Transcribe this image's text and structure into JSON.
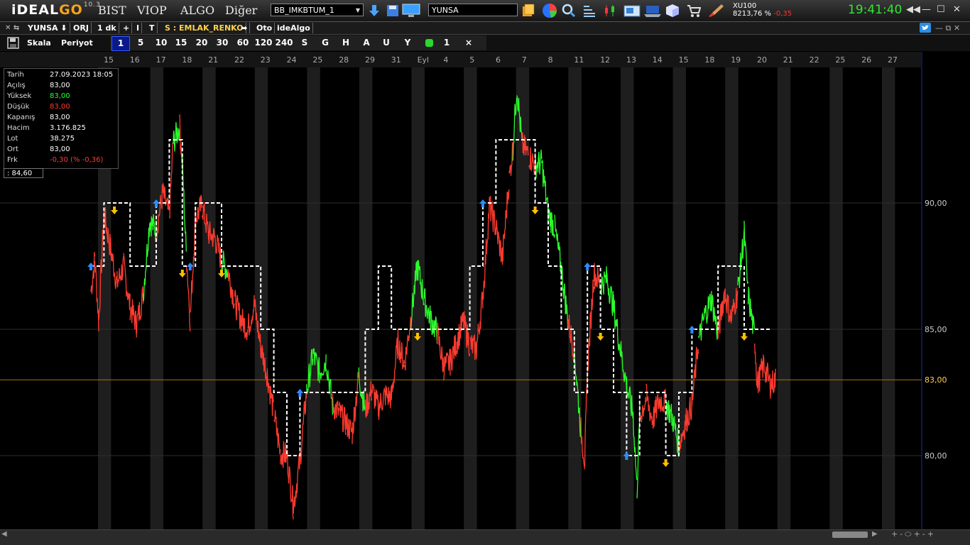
{
  "app": {
    "logo_main": "iDEAL",
    "logo_accent": "GO",
    "version": "10.3"
  },
  "menu": [
    "BIST",
    "VIOP",
    "ALGO",
    "Diğer"
  ],
  "toolbar": {
    "list_combo": "BB_IMKBTUM_1",
    "symbol_input": "YUNSA"
  },
  "index": {
    "name": "XU100",
    "value": "8213,76",
    "pct_label": "%",
    "change": "-0,35"
  },
  "clock": "19:41:40",
  "subtoolbar": {
    "symbol": "YUNSA",
    "items": [
      "ORJ",
      "1 dk",
      "+",
      "I",
      "T"
    ],
    "strategy": "S : EMLAK_RENKO",
    "oto": "Oto",
    "idealgo": "ideAlgo"
  },
  "period_bar": {
    "skala": "Skala",
    "periyot": "Periyot",
    "periods": [
      "1",
      "5",
      "10",
      "15",
      "20",
      "30",
      "60",
      "120",
      "240",
      "S",
      "G",
      "H",
      "A",
      "U",
      "Y"
    ],
    "active": "1",
    "count": "1",
    "close": "×"
  },
  "info_box": {
    "rows": [
      {
        "k": "Tarih",
        "v": "27.09.2023 18:05"
      },
      {
        "k": "Açılış",
        "v": "83,00"
      },
      {
        "k": "Yüksek",
        "v": "83,00"
      },
      {
        "k": "Düşük",
        "v": "83,00"
      },
      {
        "k": "Kapanış",
        "v": "83,00"
      },
      {
        "k": "Hacim",
        "v": "3.176.825"
      },
      {
        "k": "Lot",
        "v": "38.275"
      },
      {
        "k": "Ort",
        "v": "83,00"
      },
      {
        "k": "Frk",
        "v": "-0,30 (% -0,36)"
      }
    ],
    "cursor_value": ": 84,60"
  },
  "colors": {
    "up": "#2bff2b",
    "down": "#ff3b30",
    "renko": "#ffffff",
    "buy": "#2f8cff",
    "sell": "#ffc000",
    "last_line": "#a07800",
    "grid": "#2e2e2e",
    "clock": "#32e632"
  },
  "chart_data": {
    "type": "line",
    "y_ticks": [
      "90,00",
      "85,00",
      "80,00"
    ],
    "last_price_label": "83,00",
    "last_price": 83.0,
    "ylim": [
      77,
      93
    ],
    "date_labels": [
      "15",
      "16",
      "17",
      "18",
      "21",
      "22",
      "23",
      "24",
      "25",
      "28",
      "29",
      "31",
      "Eyl",
      "4",
      "5",
      "6",
      "7",
      "8",
      "11",
      "12",
      "13",
      "14",
      "15",
      "18",
      "19",
      "20",
      "21",
      "22",
      "25",
      "26",
      "27"
    ],
    "renko_steps": [
      {
        "from": 0,
        "to": 1,
        "level": 87.5
      },
      {
        "from": 1,
        "to": 3,
        "level": 90.0
      },
      {
        "from": 3,
        "to": 5,
        "level": 87.5
      },
      {
        "from": 5,
        "to": 6,
        "level": 90.0
      },
      {
        "from": 6,
        "to": 7,
        "level": 92.5
      },
      {
        "from": 7,
        "to": 8,
        "level": 87.5
      },
      {
        "from": 8,
        "to": 10,
        "level": 90.0
      },
      {
        "from": 10,
        "to": 13,
        "level": 87.5
      },
      {
        "from": 13,
        "to": 14,
        "level": 85.0
      },
      {
        "from": 14,
        "to": 15,
        "level": 82.5
      },
      {
        "from": 15,
        "to": 16,
        "level": 80.0
      },
      {
        "from": 16,
        "to": 21,
        "level": 82.5
      },
      {
        "from": 21,
        "to": 22,
        "level": 85.0
      },
      {
        "from": 22,
        "to": 23,
        "level": 87.5
      },
      {
        "from": 23,
        "to": 29,
        "level": 85.0
      },
      {
        "from": 29,
        "to": 30,
        "level": 87.5
      },
      {
        "from": 30,
        "to": 31,
        "level": 90.0
      },
      {
        "from": 31,
        "to": 34,
        "level": 92.5
      },
      {
        "from": 34,
        "to": 35,
        "level": 90.0
      },
      {
        "from": 35,
        "to": 36,
        "level": 87.5
      },
      {
        "from": 36,
        "to": 37,
        "level": 85.0
      },
      {
        "from": 37,
        "to": 38,
        "level": 82.5
      },
      {
        "from": 38,
        "to": 39,
        "level": 87.5
      },
      {
        "from": 39,
        "to": 40,
        "level": 85.0
      },
      {
        "from": 40,
        "to": 41,
        "level": 82.5
      },
      {
        "from": 41,
        "to": 42,
        "level": 80.0
      },
      {
        "from": 42,
        "to": 44,
        "level": 82.5
      },
      {
        "from": 44,
        "to": 45,
        "level": 80.0
      },
      {
        "from": 45,
        "to": 46,
        "level": 82.5
      },
      {
        "from": 46,
        "to": 48,
        "level": 85.0
      },
      {
        "from": 48,
        "to": 50,
        "level": 87.5
      },
      {
        "from": 50,
        "to": 52,
        "level": 85.0
      }
    ],
    "price_path": [
      [
        0,
        86.5
      ],
      [
        0.3,
        87.8
      ],
      [
        0.6,
        85.3
      ],
      [
        1,
        89.6
      ],
      [
        1.5,
        88.2
      ],
      [
        2,
        86.8
      ],
      [
        2.5,
        87.5
      ],
      [
        3,
        85.9
      ],
      [
        3.5,
        85.2
      ],
      [
        4,
        86.4
      ],
      [
        4.5,
        89.3
      ],
      [
        5,
        88.9
      ],
      [
        5.5,
        90.4
      ],
      [
        6,
        89.5
      ],
      [
        6.3,
        92.4
      ],
      [
        6.8,
        93.0
      ],
      [
        7,
        91.5
      ],
      [
        7.3,
        88.0
      ],
      [
        7.6,
        85.4
      ],
      [
        8,
        89.4
      ],
      [
        8.5,
        89.9
      ],
      [
        9,
        88.8
      ],
      [
        9.5,
        88.6
      ],
      [
        10,
        87.7
      ],
      [
        10.5,
        87.3
      ],
      [
        11,
        86.1
      ],
      [
        11.5,
        85.4
      ],
      [
        12,
        85.0
      ],
      [
        12.5,
        86.0
      ],
      [
        13,
        84.3
      ],
      [
        13.5,
        83.2
      ],
      [
        14,
        81.7
      ],
      [
        14.5,
        80.1
      ],
      [
        15,
        80.0
      ],
      [
        15.5,
        78.0
      ],
      [
        16,
        79.8
      ],
      [
        16.5,
        82.5
      ],
      [
        17,
        84.0
      ],
      [
        17.5,
        83.3
      ],
      [
        18,
        83.8
      ],
      [
        18.5,
        82.0
      ],
      [
        19,
        81.7
      ],
      [
        19.5,
        81.3
      ],
      [
        20,
        80.9
      ],
      [
        20.5,
        83.2
      ],
      [
        21,
        81.8
      ],
      [
        21.5,
        82.6
      ],
      [
        22,
        81.9
      ],
      [
        22.5,
        82.4
      ],
      [
        23,
        82.3
      ],
      [
        23.5,
        84.5
      ],
      [
        24,
        83.6
      ],
      [
        24.5,
        85.5
      ],
      [
        25,
        87.5
      ],
      [
        25.5,
        86.2
      ],
      [
        26,
        85.4
      ],
      [
        26.5,
        84.9
      ],
      [
        27,
        83.5
      ],
      [
        27.5,
        83.7
      ],
      [
        28,
        84.5
      ],
      [
        28.5,
        85.3
      ],
      [
        29,
        84.4
      ],
      [
        29.5,
        84.2
      ],
      [
        30,
        86.3
      ],
      [
        30.5,
        89.9
      ],
      [
        31,
        89.0
      ],
      [
        31.5,
        87.8
      ],
      [
        32,
        90.9
      ],
      [
        32.3,
        92.2
      ],
      [
        32.6,
        94.6
      ],
      [
        33,
        92.3
      ],
      [
        33.5,
        91.9
      ],
      [
        34,
        91.5
      ],
      [
        34.5,
        91.6
      ],
      [
        35,
        89.6
      ],
      [
        35.5,
        89.0
      ],
      [
        36,
        87.4
      ],
      [
        36.5,
        85.4
      ],
      [
        37,
        84.1
      ],
      [
        37.5,
        81.0
      ],
      [
        37.8,
        79.8
      ],
      [
        38,
        83.4
      ],
      [
        38.5,
        87.2
      ],
      [
        39,
        86.8
      ],
      [
        39.5,
        87.0
      ],
      [
        40,
        85.9
      ],
      [
        40.5,
        84.3
      ],
      [
        41,
        82.8
      ],
      [
        41.5,
        81.6
      ],
      [
        41.8,
        78.7
      ],
      [
        42,
        81.5
      ],
      [
        42.5,
        82.3
      ],
      [
        43,
        81.4
      ],
      [
        43.5,
        82.2
      ],
      [
        44,
        82.1
      ],
      [
        44.5,
        81.5
      ],
      [
        45,
        80.4
      ],
      [
        45.5,
        81.3
      ],
      [
        46,
        82.0
      ],
      [
        46.5,
        84.5
      ],
      [
        47,
        85.6
      ],
      [
        47.5,
        86.2
      ],
      [
        48,
        84.8
      ],
      [
        48.5,
        86.5
      ],
      [
        49,
        85.4
      ],
      [
        49.5,
        86.5
      ],
      [
        50,
        88.8
      ],
      [
        50.3,
        86.4
      ],
      [
        50.8,
        84.7
      ],
      [
        51,
        82.8
      ],
      [
        51.5,
        83.6
      ],
      [
        52,
        82.8
      ],
      [
        52.4,
        83.0
      ]
    ],
    "signals": [
      {
        "t": 0,
        "type": "buy"
      },
      {
        "t": 1.8,
        "type": "sell"
      },
      {
        "t": 5,
        "type": "buy"
      },
      {
        "t": 7,
        "type": "sell"
      },
      {
        "t": 7.6,
        "type": "buy"
      },
      {
        "t": 10,
        "type": "sell"
      },
      {
        "t": 16,
        "type": "buy"
      },
      {
        "t": 25,
        "type": "sell"
      },
      {
        "t": 30,
        "type": "buy"
      },
      {
        "t": 34,
        "type": "sell"
      },
      {
        "t": 38,
        "type": "buy"
      },
      {
        "t": 39,
        "type": "sell"
      },
      {
        "t": 41,
        "type": "buy"
      },
      {
        "t": 44,
        "type": "sell"
      },
      {
        "t": 46,
        "type": "buy"
      },
      {
        "t": 50,
        "type": "sell"
      }
    ]
  }
}
